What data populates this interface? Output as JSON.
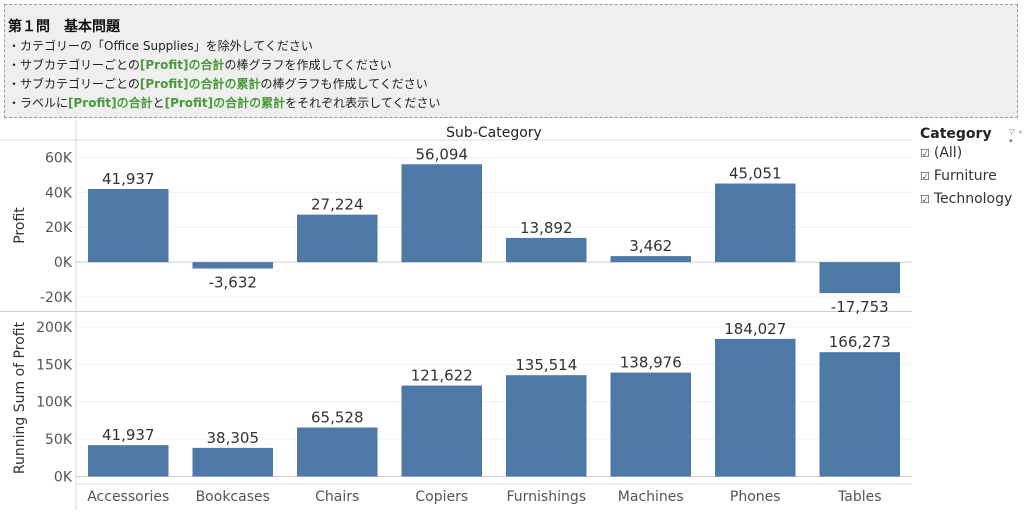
{
  "task": {
    "title": "第１問　基本問題",
    "lines": [
      [
        {
          "t": "・カテゴリーの「Office Supplies」を除外してください"
        }
      ],
      [
        {
          "t": "・サブカテゴリーごとの"
        },
        {
          "t": "[Profit]の合計",
          "hl": true
        },
        {
          "t": "の棒グラフを作成してください"
        }
      ],
      [
        {
          "t": "・サブカテゴリーごとの"
        },
        {
          "t": "[Profit]の合計の累計",
          "hl": true
        },
        {
          "t": "の棒グラフも作成してください"
        }
      ],
      [
        {
          "t": "・ラベルに"
        },
        {
          "t": "[Profit]の合計",
          "hl": true
        },
        {
          "t": "と"
        },
        {
          "t": "[Profit]の合計の累計",
          "hl": true
        },
        {
          "t": "をそれぞれ表示してください"
        }
      ]
    ]
  },
  "legend": {
    "title": "Category",
    "tools": "▽ ⌕ ▾",
    "checkbox_glyph": "☑",
    "items": [
      "(All)",
      "Furniture",
      "Technology"
    ]
  },
  "chart_data": {
    "type": "bar",
    "title": "Sub-Category",
    "bar_color": "#4e79a7",
    "categories": [
      "Accessories",
      "Bookcases",
      "Chairs",
      "Copiers",
      "Furnishings",
      "Machines",
      "Phones",
      "Tables"
    ],
    "panels": [
      {
        "ylabel": "Profit",
        "ylim": [
          -28000,
          70000
        ],
        "ticks": [
          -20000,
          0,
          20000,
          40000,
          60000
        ],
        "tick_labels": [
          "-20K",
          "0K",
          "20K",
          "40K",
          "60K"
        ],
        "values": [
          41937,
          -3632,
          27224,
          56094,
          13892,
          3462,
          45051,
          -17753
        ],
        "labels": [
          "41,937",
          "-3,632",
          "27,224",
          "56,094",
          "13,892",
          "3,462",
          "45,051",
          "-17,753"
        ]
      },
      {
        "ylabel": "Running Sum of Profit",
        "ylim": [
          -10000,
          220000
        ],
        "ticks": [
          0,
          50000,
          100000,
          150000,
          200000
        ],
        "tick_labels": [
          "0K",
          "50K",
          "100K",
          "150K",
          "200K"
        ],
        "values": [
          41937,
          38305,
          65528,
          121622,
          135514,
          138976,
          184027,
          166273
        ],
        "labels": [
          "41,937",
          "38,305",
          "65,528",
          "121,622",
          "135,514",
          "138,976",
          "184,027",
          "166,273"
        ]
      }
    ]
  }
}
